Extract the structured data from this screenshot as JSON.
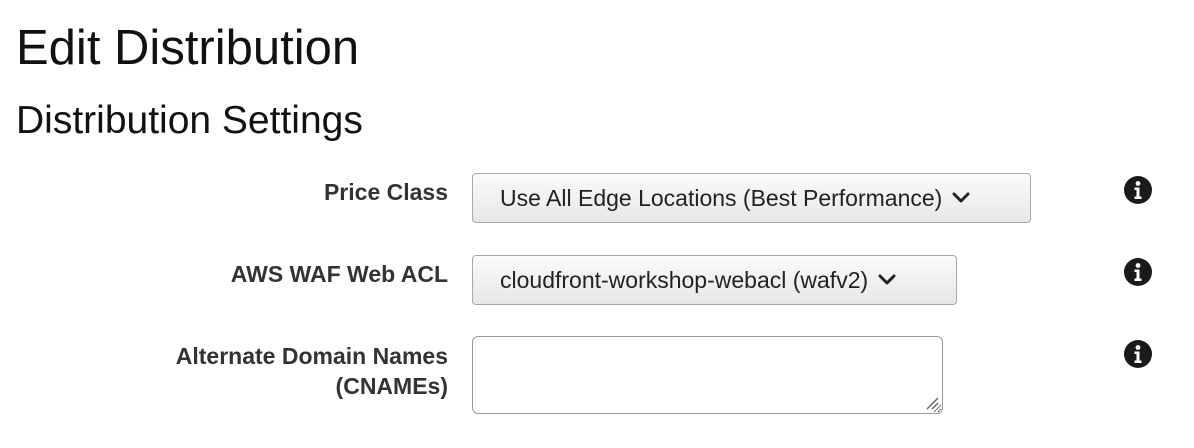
{
  "page": {
    "title": "Edit Distribution",
    "section_title": "Distribution Settings"
  },
  "fields": {
    "price_class": {
      "label": "Price Class",
      "selected": "Use All Edge Locations (Best Performance)"
    },
    "waf_web_acl": {
      "label": "AWS WAF Web ACL",
      "selected": "cloudfront-workshop-webacl (wafv2)"
    },
    "cnames": {
      "label_line1": "Alternate Domain Names",
      "label_line2": "(CNAMEs)",
      "value": ""
    }
  },
  "icons": {
    "dropdown": "chevron-down-icon",
    "info": "info-icon",
    "resize": "resize-grip-icon"
  },
  "colors": {
    "select_gradient_top": "#fbfbfb",
    "select_gradient_bottom": "#e7e7e7",
    "label_text": "#333333",
    "info_icon": "#1a1a1a"
  }
}
